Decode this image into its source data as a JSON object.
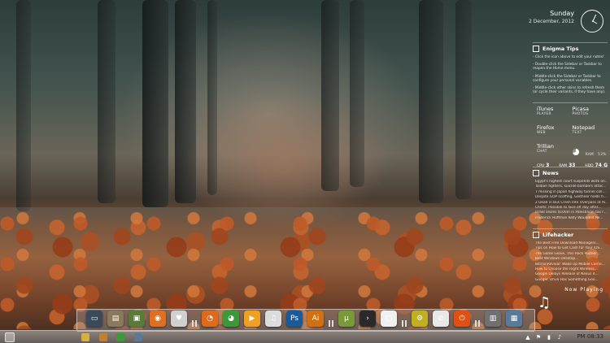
{
  "clock": {
    "day": "Sunday",
    "date": "2 December, 2012"
  },
  "tips": {
    "title": "Enigma Tips",
    "lines": [
      "- Click the icon above to edit your notes!",
      "- Double-click the Sidebar or Taskbar to reopen the Home menu.",
      "- Middle-click the Sidebar or Taskbar to configure your personal variables.",
      "- Middle-click other skins to refresh them (or cycle their variants, if they have any)."
    ]
  },
  "launchers": [
    {
      "name": "iTunes",
      "sub": "PLAYER"
    },
    {
      "name": "Picasa",
      "sub": "PHOTOS"
    },
    {
      "name": "Firefox",
      "sub": "WEB"
    },
    {
      "name": "Notepad",
      "sub": "TEXT"
    },
    {
      "name": "Trillian",
      "sub": "CHAT"
    },
    {
      "name": "RAM",
      "sub": "53%"
    }
  ],
  "stats": {
    "cpu_label": "CPU",
    "cpu_value": "3",
    "ram_label": "RAM",
    "ram_value": "33",
    "hdd_label": "HDD",
    "hdd_value": "74 G"
  },
  "news": {
    "title": "News",
    "items": [
      "Egypt's highest court suspends work on...",
      "Taliban fighters, suicide bombers attac...",
      "7 missing in Japan highway tunnel coll...",
      "Despite GOP scoffing, Geithner holds fi...",
      "2 Dead in Bus Crash Into Overpass at Ai...",
      "Chiefs: Possible to face off day after...",
      "Israel seizes $100m in Palestinian tax r...",
      "Frederick Hoffman Kelly Wounded Re..."
    ]
  },
  "lifehacker": {
    "title": "Lifehacker",
    "items": [
      "The Best Free Download Managers...",
      "Tips on How to Get Cash for Your iOS...",
      "The Game Genie, This Rock Puzzler...",
      "Best Windows Desktop...",
      "BitchinRevival: Wake Up Mobile Carrie...",
      "How to Choose the Right Wireless...",
      "Google Delays Release of Nexus 4...",
      "Google: Drive Has Something Goo..."
    ]
  },
  "now_playing": "Now Playing",
  "dock_icons": [
    {
      "name": "my-computer-icon",
      "glyph": "▭",
      "color": "#3a4a5a"
    },
    {
      "name": "documents-icon",
      "glyph": "▤",
      "color": "#8a7a5a"
    },
    {
      "name": "pictures-icon",
      "glyph": "▣",
      "color": "#5a7a3a"
    },
    {
      "name": "music-icon",
      "glyph": "◉",
      "color": "#e07020"
    },
    {
      "name": "favorites-icon",
      "glyph": "♥",
      "color": "#d0d0d0"
    },
    {
      "name": "firefox-icon",
      "glyph": "◔",
      "color": "#e06a1a"
    },
    {
      "name": "chrome-icon",
      "glyph": "◕",
      "color": "#3a9a3a"
    },
    {
      "name": "media-player-icon",
      "glyph": "▶",
      "color": "#f0a020"
    },
    {
      "name": "itunes-icon",
      "glyph": "♫",
      "color": "#dcdcdc"
    },
    {
      "name": "photoshop-icon",
      "glyph": "Ps",
      "color": "#1a5a9a"
    },
    {
      "name": "illustrator-icon",
      "glyph": "Ai",
      "color": "#d07010"
    },
    {
      "name": "utorrent-icon",
      "glyph": "µ",
      "color": "#7a9a3a"
    },
    {
      "name": "terminal-icon",
      "glyph": "›",
      "color": "#2a2a2a"
    },
    {
      "name": "notepad-icon",
      "glyph": "▢",
      "color": "#f0f0f0"
    },
    {
      "name": "settings-icon",
      "glyph": "⚙",
      "color": "#c0b020"
    },
    {
      "name": "no-entry-icon",
      "glyph": "⊘",
      "color": "#e8e8e8"
    },
    {
      "name": "power-icon",
      "glyph": "⏻",
      "color": "#e05010"
    },
    {
      "name": "trash-icon",
      "glyph": "▥",
      "color": "#707070"
    },
    {
      "name": "control-panel-icon",
      "glyph": "▦",
      "color": "#5a7a9a"
    }
  ],
  "taskbar_time": "PM 08:33"
}
